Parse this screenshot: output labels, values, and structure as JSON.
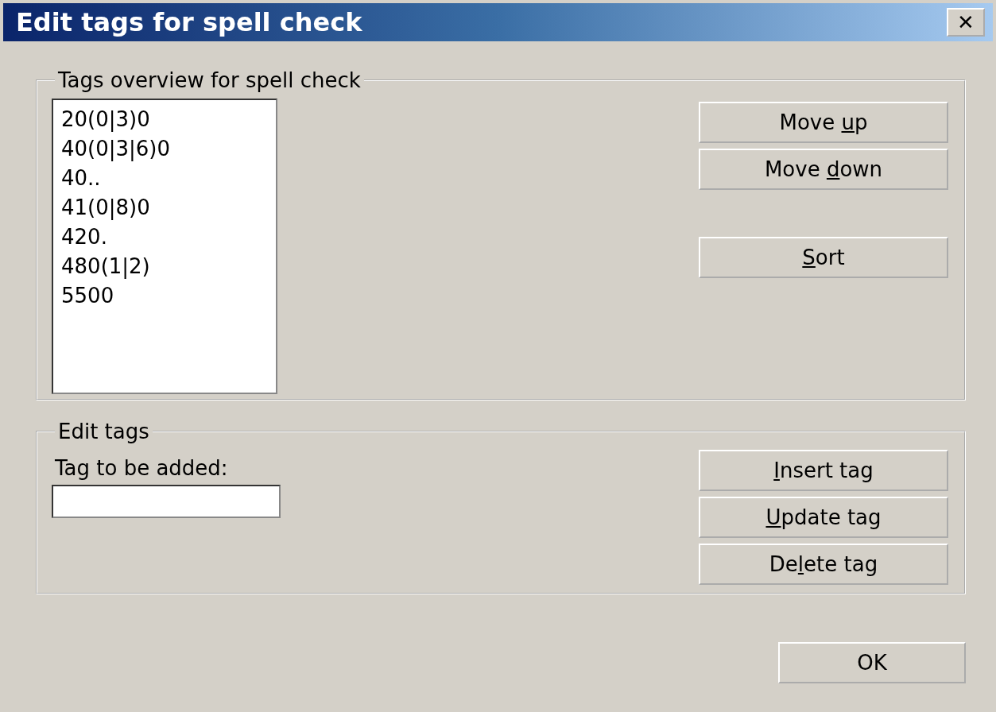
{
  "window": {
    "title": "Edit tags for spell check",
    "close": "✕"
  },
  "overview": {
    "legend": "Tags overview for spell check",
    "tags": [
      {
        "text": "20(0|3)0",
        "selected": false
      },
      {
        "text": "40(0|3|6)0",
        "selected": false
      },
      {
        "text": "40..",
        "selected": false
      },
      {
        "text": "41(0|8)0",
        "selected": false
      },
      {
        "text": "420.",
        "selected": false
      },
      {
        "text": "480(1|2)",
        "selected": false
      },
      {
        "text": "5500",
        "selected": false
      }
    ],
    "buttons": [
      {
        "before": "Move ",
        "key": "u",
        "after": "p"
      },
      {
        "before": "Move ",
        "key": "d",
        "after": "own"
      },
      {
        "key": "S",
        "after": "ort"
      }
    ]
  },
  "edit": {
    "legend": "Edit tags",
    "field_label": "Tag to be added:",
    "buttons": [
      {
        "key": "I",
        "after": "nsert tag"
      },
      {
        "key": "U",
        "after": "pdate tag"
      },
      {
        "before": "De",
        "key": "l",
        "after": "ete tag"
      }
    ]
  },
  "ok": "OK"
}
